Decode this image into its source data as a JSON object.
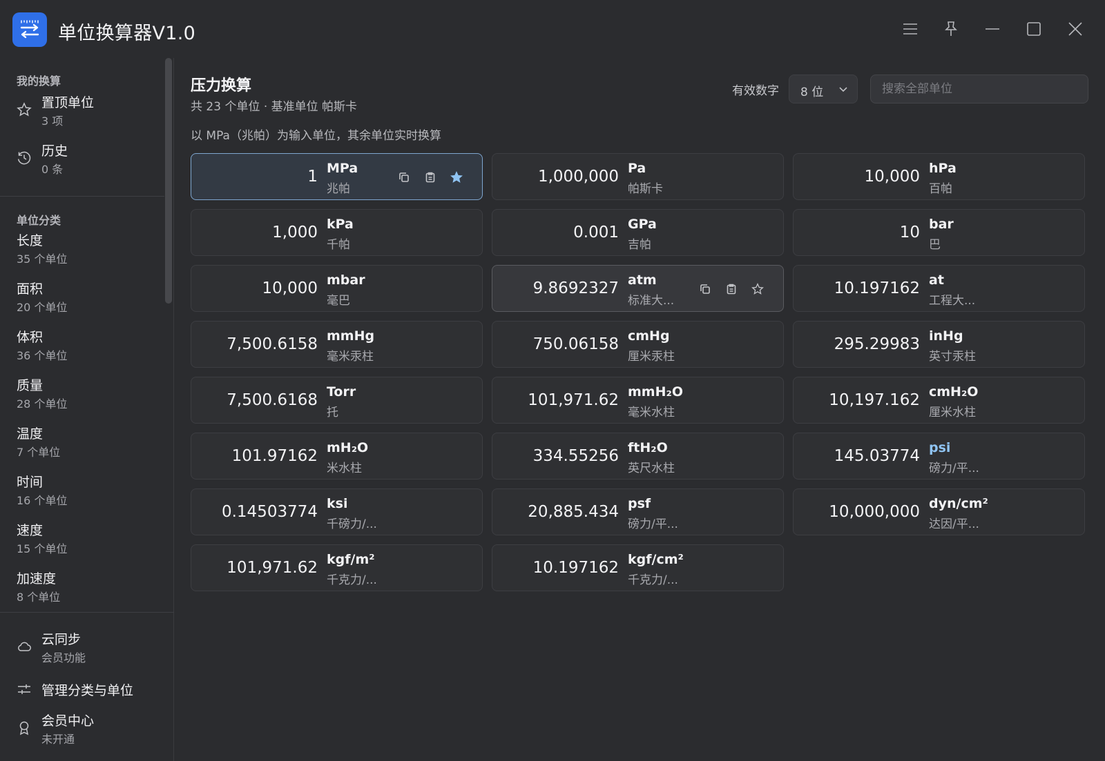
{
  "app": {
    "title": "单位换算器V1.0"
  },
  "sidebar": {
    "my_section": "我的换算",
    "pinned": {
      "label": "置顶单位",
      "sub": "3 项"
    },
    "history": {
      "label": "历史",
      "sub": "0 条"
    },
    "cat_section": "单位分类",
    "categories": [
      {
        "label": "长度",
        "sub": "35 个单位"
      },
      {
        "label": "面积",
        "sub": "20 个单位"
      },
      {
        "label": "体积",
        "sub": "36 个单位"
      },
      {
        "label": "质量",
        "sub": "28 个单位"
      },
      {
        "label": "温度",
        "sub": "7 个单位"
      },
      {
        "label": "时间",
        "sub": "16 个单位"
      },
      {
        "label": "速度",
        "sub": "15 个单位"
      },
      {
        "label": "加速度",
        "sub": "8 个单位"
      }
    ],
    "cloud": {
      "label": "云同步",
      "sub": "会员功能"
    },
    "manage": {
      "label": "管理分类与单位"
    },
    "member": {
      "label": "会员中心",
      "sub": "未开通"
    }
  },
  "main": {
    "title": "压力换算",
    "subtitle": "共 23 个单位 · 基准单位 帕斯卡",
    "hint": "以 MPa（兆帕）为输入单位，其余单位实时换算",
    "sig_label": "有效数字",
    "sig_value": "8 位",
    "search_placeholder": "搜索全部单位"
  },
  "units": [
    {
      "value": "1",
      "symbol": "MPa",
      "name": "兆帕",
      "state": "active",
      "starred": true
    },
    {
      "value": "1,000,000",
      "symbol": "Pa",
      "name": "帕斯卡"
    },
    {
      "value": "10,000",
      "symbol": "hPa",
      "name": "百帕"
    },
    {
      "value": "1,000",
      "symbol": "kPa",
      "name": "千帕"
    },
    {
      "value": "0.001",
      "symbol": "GPa",
      "name": "吉帕"
    },
    {
      "value": "10",
      "symbol": "bar",
      "name": "巴"
    },
    {
      "value": "10,000",
      "symbol": "mbar",
      "name": "毫巴"
    },
    {
      "value": "9.8692327",
      "symbol": "atm",
      "name": "标准大...",
      "state": "hover",
      "starred": false
    },
    {
      "value": "10.197162",
      "symbol": "at",
      "name": "工程大..."
    },
    {
      "value": "7,500.6158",
      "symbol": "mmHg",
      "name": "毫米汞柱"
    },
    {
      "value": "750.06158",
      "symbol": "cmHg",
      "name": "厘米汞柱"
    },
    {
      "value": "295.29983",
      "symbol": "inHg",
      "name": "英寸汞柱"
    },
    {
      "value": "7,500.6168",
      "symbol": "Torr",
      "name": "托"
    },
    {
      "value": "101,971.62",
      "symbol": "mmH₂O",
      "name": "毫米水柱"
    },
    {
      "value": "10,197.162",
      "symbol": "cmH₂O",
      "name": "厘米水柱"
    },
    {
      "value": "101.97162",
      "symbol": "mH₂O",
      "name": "米水柱"
    },
    {
      "value": "334.55256",
      "symbol": "ftH₂O",
      "name": "英尺水柱"
    },
    {
      "value": "145.03774",
      "symbol": "psi",
      "name": "磅力/平...",
      "link": true
    },
    {
      "value": "0.14503774",
      "symbol": "ksi",
      "name": "千磅力/..."
    },
    {
      "value": "20,885.434",
      "symbol": "psf",
      "name": "磅力/平..."
    },
    {
      "value": "10,000,000",
      "symbol": "dyn/cm²",
      "name": "达因/平..."
    },
    {
      "value": "101,971.62",
      "symbol": "kgf/m²",
      "name": "千克力/..."
    },
    {
      "value": "10.197162",
      "symbol": "kgf/cm²",
      "name": "千克力/..."
    }
  ]
}
